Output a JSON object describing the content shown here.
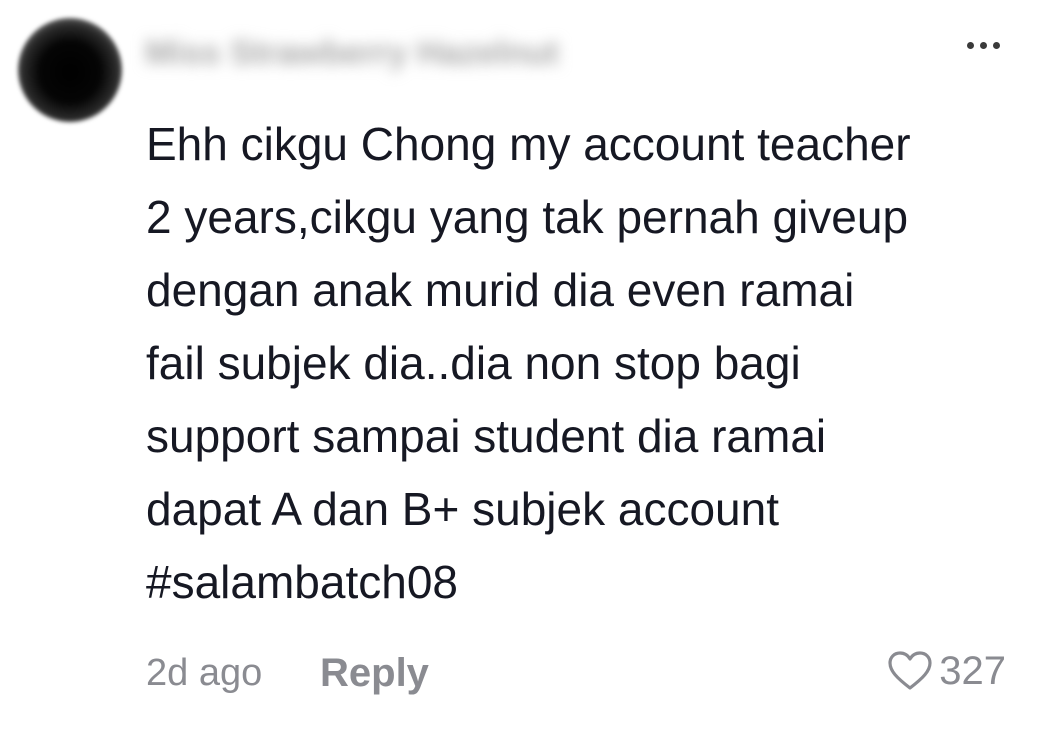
{
  "comment": {
    "username": "Miss Strawberry Hazelnut",
    "text": "Ehh cikgu Chong my account teacher\n2 years,cikgu yang tak pernah giveup\ndengan anak murid dia even ramai\nfail subjek dia..dia non stop bagi\nsupport sampai student dia ramai\ndapat A dan B+ subjek account\n#salambatch08",
    "timestamp": "2d ago",
    "reply_label": "Reply",
    "like_count": "327",
    "avatar_icon": "user-avatar",
    "more_icon": "more-options-icon",
    "like_icon": "heart-outline-icon"
  },
  "colors": {
    "text": "#161823",
    "muted": "#8a8b91",
    "background": "#ffffff"
  }
}
